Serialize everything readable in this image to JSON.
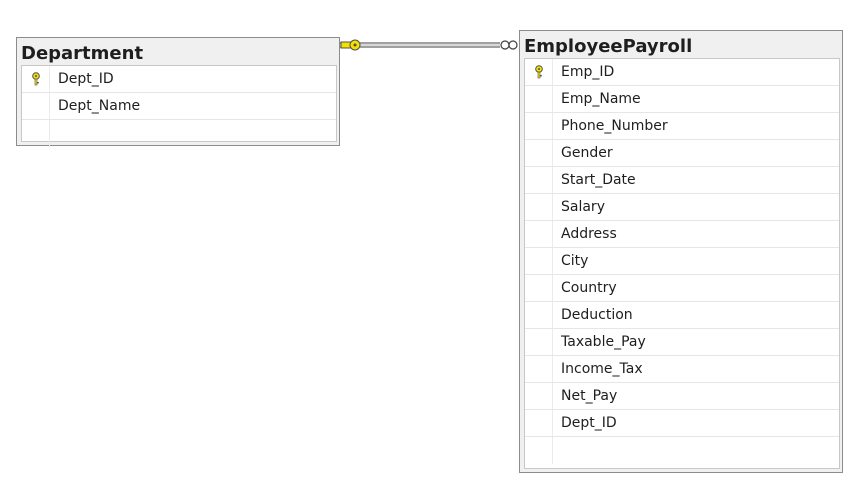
{
  "diagram": {
    "tables": {
      "department": {
        "title": "Department",
        "columns": [
          {
            "name": "Dept_ID",
            "primary_key": true
          },
          {
            "name": "Dept_Name",
            "primary_key": false
          }
        ]
      },
      "employee_payroll": {
        "title": "EmployeePayroll",
        "columns": [
          {
            "name": "Emp_ID",
            "primary_key": true
          },
          {
            "name": "Emp_Name",
            "primary_key": false
          },
          {
            "name": "Phone_Number",
            "primary_key": false
          },
          {
            "name": "Gender",
            "primary_key": false
          },
          {
            "name": "Start_Date",
            "primary_key": false
          },
          {
            "name": "Salary",
            "primary_key": false
          },
          {
            "name": "Address",
            "primary_key": false
          },
          {
            "name": "City",
            "primary_key": false
          },
          {
            "name": "Country",
            "primary_key": false
          },
          {
            "name": "Deduction",
            "primary_key": false
          },
          {
            "name": "Taxable_Pay",
            "primary_key": false
          },
          {
            "name": "Income_Tax",
            "primary_key": false
          },
          {
            "name": "Net_Pay",
            "primary_key": false
          },
          {
            "name": "Dept_ID",
            "primary_key": false
          }
        ]
      }
    },
    "relationship": {
      "from": "Department",
      "to": "EmployeePayroll",
      "from_end": "one",
      "to_end": "many"
    },
    "colors": {
      "key_icon": "#f5e000",
      "border": "#8c8c8c",
      "header_bg": "#f0f0f0"
    }
  }
}
